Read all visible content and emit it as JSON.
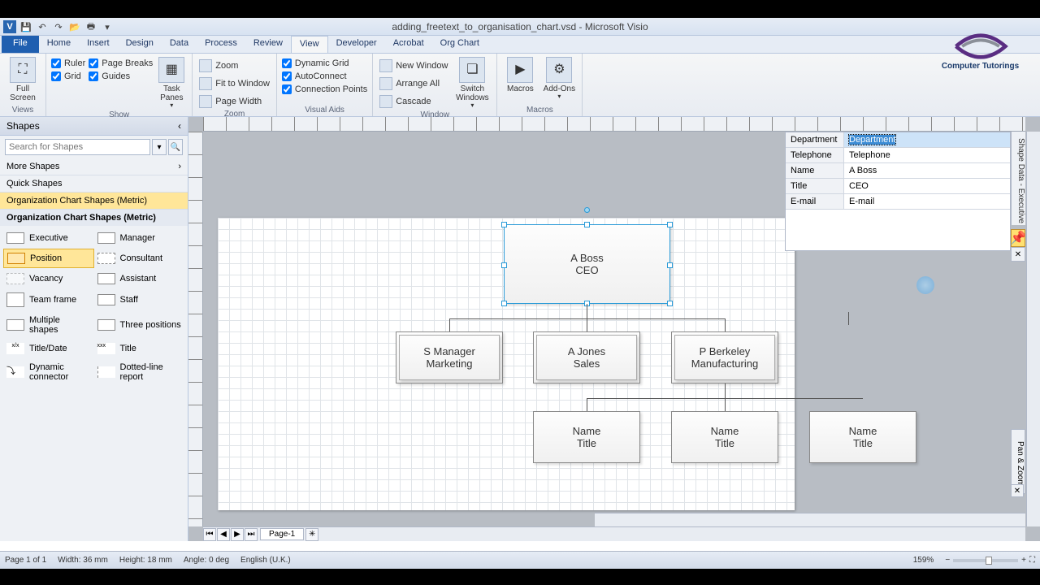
{
  "title": "adding_freetext_to_organisation_chart.vsd - Microsoft Visio",
  "tabs": [
    "File",
    "Home",
    "Insert",
    "Design",
    "Data",
    "Process",
    "Review",
    "View",
    "Developer",
    "Acrobat",
    "Org Chart"
  ],
  "active_tab": "View",
  "ribbon": {
    "views": {
      "full_screen": "Full Screen",
      "label": "Views"
    },
    "show": {
      "ruler": "Ruler",
      "page_breaks": "Page Breaks",
      "grid": "Grid",
      "guides": "Guides",
      "task_panes": "Task Panes",
      "label": "Show"
    },
    "zoom": {
      "zoom": "Zoom",
      "fit": "Fit to Window",
      "page_width": "Page Width",
      "label": "Zoom"
    },
    "visual_aids": {
      "dynamic_grid": "Dynamic Grid",
      "autoconnect": "AutoConnect",
      "connection_points": "Connection Points",
      "label": "Visual Aids"
    },
    "window": {
      "new_window": "New Window",
      "arrange_all": "Arrange All",
      "cascade": "Cascade",
      "switch": "Switch Windows",
      "label": "Window"
    },
    "macros": {
      "macros": "Macros",
      "addons": "Add-Ons",
      "label": "Macros"
    }
  },
  "shapes_panel": {
    "title": "Shapes",
    "search_placeholder": "Search for Shapes",
    "more": "More Shapes",
    "quick": "Quick Shapes",
    "stencil_selected": "Organization Chart Shapes (Metric)",
    "stencil_title": "Organization Chart Shapes (Metric)",
    "shapes": [
      {
        "label": "Executive"
      },
      {
        "label": "Manager"
      },
      {
        "label": "Position"
      },
      {
        "label": "Consultant"
      },
      {
        "label": "Vacancy"
      },
      {
        "label": "Assistant"
      },
      {
        "label": "Team frame"
      },
      {
        "label": "Staff"
      },
      {
        "label": "Multiple shapes"
      },
      {
        "label": "Three positions"
      },
      {
        "label": "Title/Date"
      },
      {
        "label": "Title"
      },
      {
        "label": "Dynamic connector"
      },
      {
        "label": "Dotted-line report"
      }
    ]
  },
  "org": {
    "boss_name": "A Boss",
    "boss_title": "CEO",
    "row2": [
      {
        "name": "S Manager",
        "title": "Marketing"
      },
      {
        "name": "A Jones",
        "title": "Sales"
      },
      {
        "name": "P Berkeley",
        "title": "Manufacturing"
      }
    ],
    "row3": [
      {
        "name": "Name",
        "title": "Title"
      },
      {
        "name": "Name",
        "title": "Title"
      },
      {
        "name": "Name",
        "title": "Title"
      }
    ]
  },
  "shape_data": {
    "tab_label": "Shape Data - Executive",
    "rows": [
      {
        "key": "Department",
        "val": "Department",
        "selected": true
      },
      {
        "key": "Telephone",
        "val": "Telephone"
      },
      {
        "key": "Name",
        "val": "A Boss"
      },
      {
        "key": "Title",
        "val": "CEO"
      },
      {
        "key": "E-mail",
        "val": "E-mail"
      }
    ]
  },
  "pan_zoom": "Pan & Zoom",
  "page_tab": "Page-1",
  "status": {
    "page": "Page 1 of 1",
    "width": "Width: 36 mm",
    "height": "Height: 18 mm",
    "angle": "Angle: 0 deg",
    "lang": "English (U.K.)",
    "zoom": "159%"
  },
  "brand": "Computer Tutorings"
}
